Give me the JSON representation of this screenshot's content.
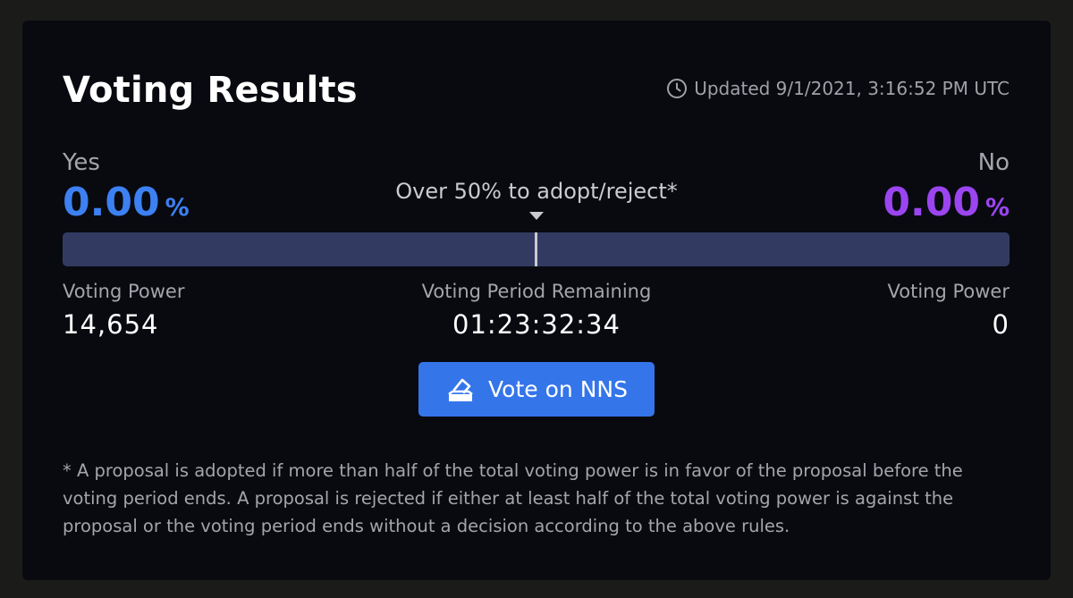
{
  "card": {
    "title": "Voting Results",
    "updated": "Updated 9/1/2021, 3:16:52 PM UTC",
    "updated_icon": "clock-icon"
  },
  "yes": {
    "label": "Yes",
    "percent": "0.00",
    "percent_symbol": "%",
    "color": "#3d80f2",
    "voting_power_label": "Voting Power",
    "voting_power": "14,654"
  },
  "no": {
    "label": "No",
    "percent": "0.00",
    "percent_symbol": "%",
    "color": "#9b45f0",
    "voting_power_label": "Voting Power",
    "voting_power": "0"
  },
  "threshold": {
    "text": "Over 50% to adopt/reject*"
  },
  "progress": {
    "yes_fraction": 0.0,
    "no_fraction": 0.0,
    "threshold_fraction": 0.5,
    "track_color": "#333a61"
  },
  "period": {
    "label": "Voting Period Remaining",
    "value": "01:23:32:34"
  },
  "vote_button": {
    "label": "Vote on NNS",
    "icon": "ballot-box-icon",
    "color": "#3575ea"
  },
  "footnote": "* A proposal is adopted if more than half of the total voting power is in favor of the proposal before the voting period ends. A proposal is rejected if either at least half of the total voting power is against the proposal or the voting period ends without a decision according to the above rules."
}
